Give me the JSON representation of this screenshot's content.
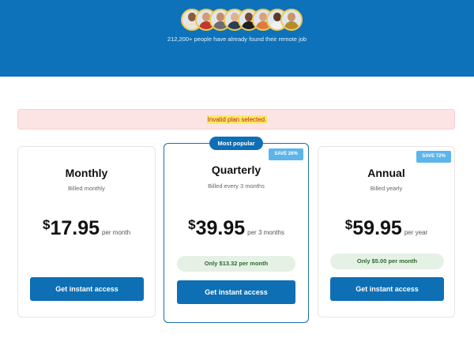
{
  "hero": {
    "subtitle": "212,200+ people have already found their remote job",
    "avatars": [
      {
        "name": "avatar-1",
        "skin": "#8a5a3c",
        "shirt": "#e9e4da"
      },
      {
        "name": "avatar-2",
        "skin": "#d29a78",
        "shirt": "#c0392b"
      },
      {
        "name": "avatar-3",
        "skin": "#c48a6a",
        "shirt": "#6d6d6d"
      },
      {
        "name": "avatar-4",
        "skin": "#e0b090",
        "shirt": "#2c3e50"
      },
      {
        "name": "avatar-5",
        "skin": "#7a4a30",
        "shirt": "#1f1f1f"
      },
      {
        "name": "avatar-6",
        "skin": "#d6a283",
        "shirt": "#e07b39"
      },
      {
        "name": "avatar-7",
        "skin": "#5b3a28",
        "shirt": "#f1f1f1"
      },
      {
        "name": "avatar-8",
        "skin": "#c8946a",
        "shirt": "#b58c2d"
      }
    ]
  },
  "alert": {
    "message": "Invalid plan selected."
  },
  "plans": {
    "monthly": {
      "title": "Monthly",
      "billing": "Billed monthly",
      "currency": "$",
      "amount": "17.95",
      "period": "per month",
      "cta": "Get instant access"
    },
    "quarterly": {
      "ribbon": "Most popular",
      "badge": "SAVE 26%",
      "title": "Quarterly",
      "billing": "Billed every 3 months",
      "currency": "$",
      "amount": "39.95",
      "period": "per 3 months",
      "savings": "Only $13.32 per month",
      "cta": "Get instant access"
    },
    "annual": {
      "badge": "SAVE 72%",
      "title": "Annual",
      "billing": "Billed yearly",
      "currency": "$",
      "amount": "59.95",
      "period": "per year",
      "savings": "Only $5.00 per month",
      "cta": "Get instant access"
    }
  },
  "colors": {
    "brand_blue": "#0d72b9",
    "alert_bg": "#fde4e4",
    "alert_text": "#b3261e",
    "highlight": "#ffe866",
    "savings_bg": "#e6f1e6",
    "savings_text": "#2e6b2e",
    "badge_bg": "#5bb5ea"
  }
}
